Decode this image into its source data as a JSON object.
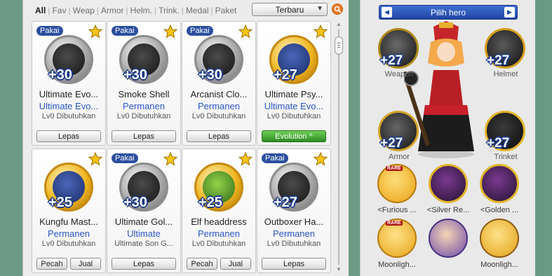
{
  "inventory": {
    "tabs": [
      "All",
      "Fav",
      "Weap",
      "Armor",
      "Helm.",
      "Trink.",
      "Medal",
      "Paket"
    ],
    "active_tab": "All",
    "sort": {
      "selected": "Terbaru"
    },
    "items": [
      {
        "badge": "Pakai",
        "name": "Ultimate Evo...",
        "type": "Ultimate Evo...",
        "req": "Lv0 Dibutuhkan",
        "plus": "+30",
        "frame": "silver",
        "inner": "dark",
        "buttons": [
          "Lepas"
        ]
      },
      {
        "badge": "Pakai",
        "name": "Smoke Shell",
        "type": "Permanen",
        "req": "Lv0 Dibutuhkan",
        "plus": "+30",
        "frame": "silver",
        "inner": "dark",
        "buttons": [
          "Lepas"
        ]
      },
      {
        "badge": "Pakai",
        "name": "Arcanist Clo...",
        "type": "Permanen",
        "req": "Lv0 Dibutuhkan",
        "plus": "+30",
        "frame": "silver",
        "inner": "dark",
        "buttons": [
          "Lepas"
        ]
      },
      {
        "badge": "",
        "name": "Ultimate Psy...",
        "type": "Ultimate Evo...",
        "req": "Lv0 Dibutuhkan",
        "plus": "+27",
        "frame": "gold",
        "inner": "blue",
        "buttons": [
          "Evolution ^"
        ]
      },
      {
        "badge": "",
        "name": "Kungfu Mast...",
        "type": "Permanen",
        "req": "Lv0 Dibutuhkan",
        "plus": "+25",
        "frame": "gold",
        "inner": "blue",
        "buttons": [
          "Pecah",
          "Jual"
        ]
      },
      {
        "badge": "Pakai",
        "name": "Ultimate Gol...",
        "type": "Ultimate",
        "req": "Ultimate Son G...",
        "plus": "+30",
        "frame": "silver",
        "inner": "dark",
        "buttons": [
          "Lepas"
        ]
      },
      {
        "badge": "",
        "name": "Elf headdress",
        "type": "Permanen",
        "req": "Lv0 Dibutuhkan",
        "plus": "+25",
        "frame": "gold",
        "inner": "green",
        "buttons": [
          "Pecah",
          "Jual"
        ]
      },
      {
        "badge": "Pakai",
        "name": "Outboxer Ha...",
        "type": "Permanen",
        "req": "Lv0 Dibutuhkan",
        "plus": "+27",
        "frame": "silver",
        "inner": "dark",
        "buttons": [
          "Lepas"
        ]
      }
    ]
  },
  "hero": {
    "title": "Pilih hero",
    "equip": [
      {
        "label": "Weapon",
        "plus": "+27"
      },
      {
        "label": "Helmet",
        "plus": "+27"
      },
      {
        "label": "Armor",
        "plus": "+27"
      },
      {
        "label": "Trinket",
        "plus": "+27"
      }
    ],
    "pets": [
      {
        "label": "<Furious ...",
        "rare": "RARE"
      },
      {
        "label": "<Silver Re...",
        "rare": ""
      },
      {
        "label": "<Golden ...",
        "rare": ""
      },
      {
        "label": "Moonligh...",
        "rare": "RARE"
      },
      {
        "label": "",
        "rare": ""
      },
      {
        "label": "Moonligh...",
        "rare": ""
      }
    ]
  },
  "colors": {
    "accent_blue": "#2a55c8",
    "badge_blue": "#2b4f9e",
    "evolution_green": "#3aa52c",
    "gold": "#f0b51f"
  }
}
